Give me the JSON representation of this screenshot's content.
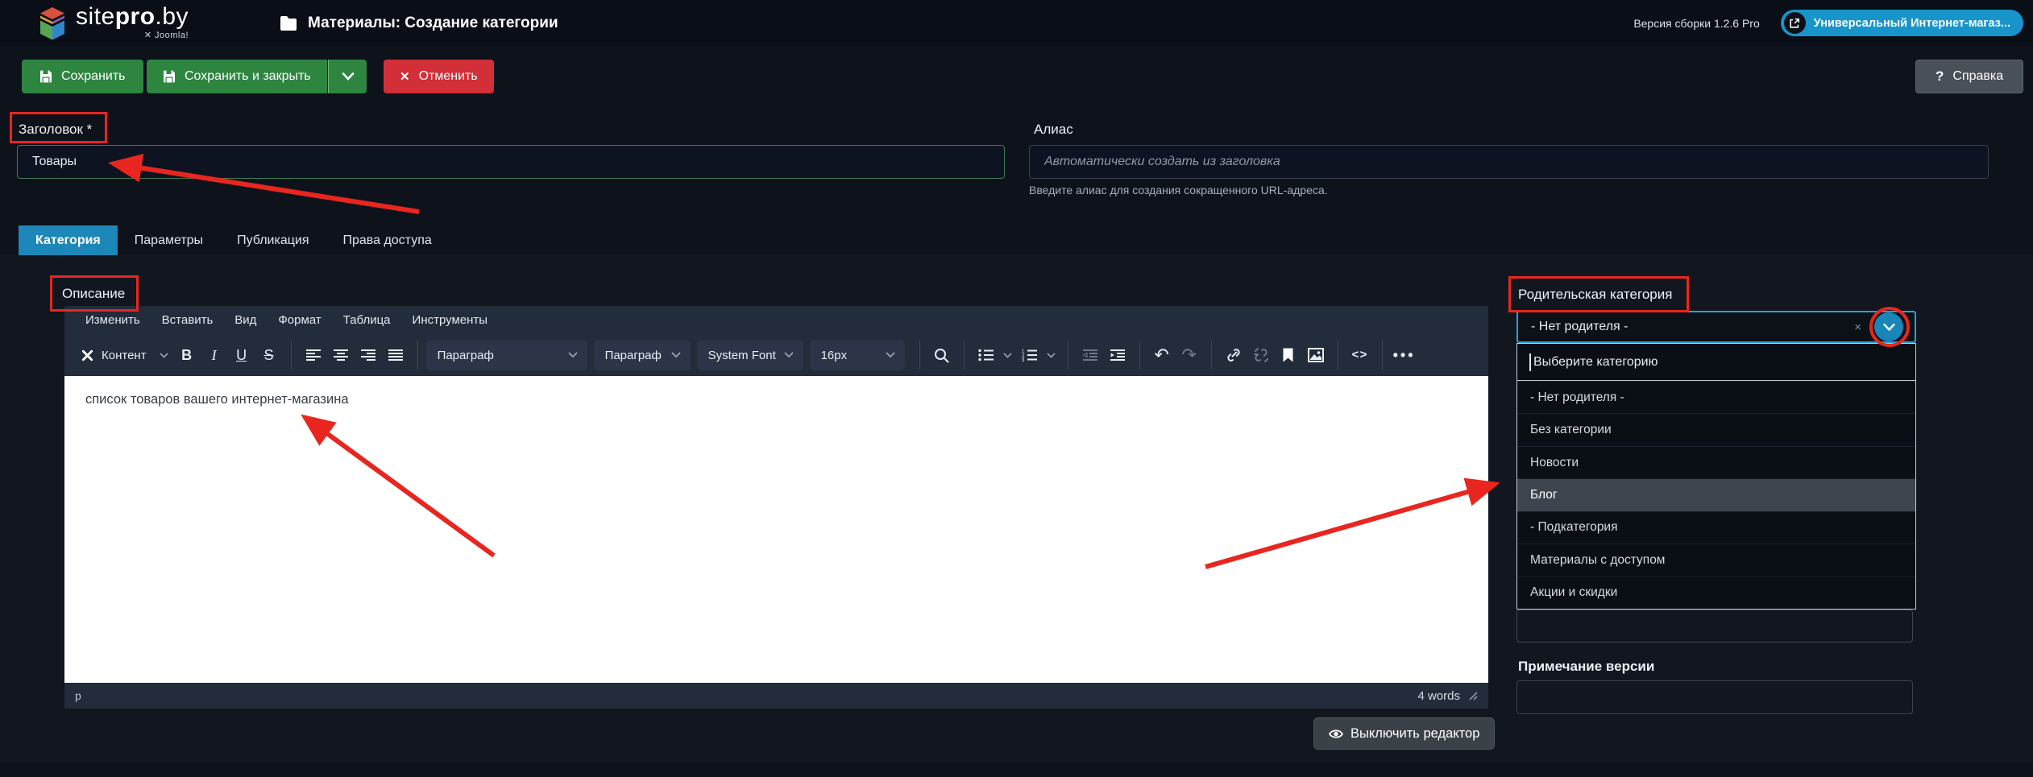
{
  "header": {
    "brand_site": "site",
    "brand_pro": "pro",
    "brand_by": ".by",
    "brand_sub": "✕ Joomla!",
    "page_title": "Материалы: Создание категории",
    "version": "Версия сборки 1.2.6 Pro",
    "template_link": "Универсальный Интернет-магаз..."
  },
  "toolbar": {
    "save": "Сохранить",
    "save_close": "Сохранить и закрыть",
    "cancel": "Отменить",
    "help": "Справка"
  },
  "title_field": {
    "label": "Заголовок *",
    "value": "Товары"
  },
  "alias_field": {
    "label": "Алиас",
    "placeholder": "Автоматически создать из заголовка",
    "help": "Введите алиас для создания сокращенного URL-адреса."
  },
  "tabs": {
    "items": [
      "Категория",
      "Параметры",
      "Публикация",
      "Права доступа"
    ],
    "active": "Категория"
  },
  "editor": {
    "description_label": "Описание",
    "menu": [
      "Изменить",
      "Вставить",
      "Вид",
      "Формат",
      "Таблица",
      "Инструменты"
    ],
    "toolbar": {
      "content_btn": "Контент",
      "style_select": "Параграф",
      "block_select": "Параграф",
      "font_select": "System Font",
      "size_select": "16px"
    },
    "content": "список товаров вашего интернет-магазина",
    "status": {
      "path": "p",
      "words": "4 words"
    },
    "disable_button": "Выключить редактор"
  },
  "parent_category": {
    "label": "Родительская категория",
    "selected": "- Нет родителя -",
    "clear_glyph": "×",
    "search_placeholder": "Выберите категорию",
    "options": [
      "- Нет родителя -",
      "Без категории",
      "Новости",
      "Блог",
      "- Подкатегория",
      "Материалы с доступом",
      "Акции и скидки"
    ],
    "highlighted": "Блог"
  },
  "version_note": {
    "label": "Примечание версии"
  },
  "colors": {
    "accent_blue": "#1d87ba",
    "pill_blue": "#1795cb",
    "success_green": "#2e8540",
    "danger_red": "#d22f38",
    "annotation_red": "#e8261f",
    "editor_chrome": "#222c3a",
    "page_bg": "#0e121b",
    "header_bg": "#0a0e17"
  }
}
